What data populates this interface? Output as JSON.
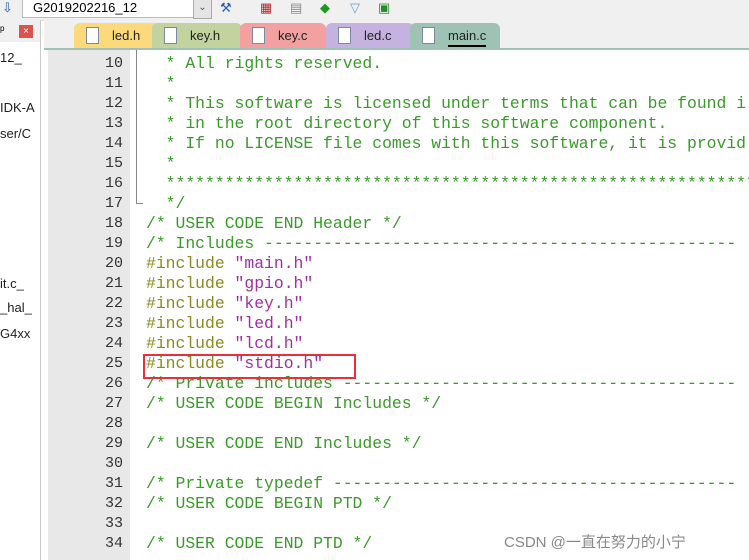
{
  "toolbar": {
    "project_combo": "G2019202216_12",
    "icons": [
      "arrow-down-icon",
      "dropdown-chevron-icon",
      "manage-components-icon",
      "options-icon",
      "layers-icon",
      "run-icon",
      "filter-icon",
      "batch-icon"
    ]
  },
  "left_panel": {
    "items": [
      "_12",
      "IDK-A",
      "ser/C",
      "_it.c",
      "_hal_",
      "G4xx"
    ],
    "close": "×"
  },
  "tabs": [
    {
      "label": "led.h",
      "color": "#fcd97a"
    },
    {
      "label": "key.h",
      "color": "#c2d3a0"
    },
    {
      "label": "key.c",
      "color": "#f2a0a0"
    },
    {
      "label": "led.c",
      "color": "#c6b2e0"
    },
    {
      "label": "main.c",
      "color": "#9ec3b5",
      "active": true
    }
  ],
  "editor": {
    "lines": [
      {
        "n": "10",
        "parts": [
          {
            "t": "  * All rights reserved.",
            "c": "cm"
          }
        ]
      },
      {
        "n": "11",
        "parts": [
          {
            "t": "  *",
            "c": "cm"
          }
        ]
      },
      {
        "n": "12",
        "parts": [
          {
            "t": "  * This software is licensed under terms that can be found i",
            "c": "cm"
          }
        ]
      },
      {
        "n": "13",
        "parts": [
          {
            "t": "  * in the root directory of this software component.",
            "c": "cm"
          }
        ]
      },
      {
        "n": "14",
        "parts": [
          {
            "t": "  * If no LICENSE file comes with this software, it is provid",
            "c": "cm"
          }
        ]
      },
      {
        "n": "15",
        "parts": [
          {
            "t": "  *",
            "c": "cm"
          }
        ]
      },
      {
        "n": "16",
        "parts": [
          {
            "t": "  *************************************************************",
            "c": "cm"
          }
        ]
      },
      {
        "n": "17",
        "parts": [
          {
            "t": "  */",
            "c": "cm"
          }
        ]
      },
      {
        "n": "18",
        "parts": [
          {
            "t": "/* USER CODE END Header */",
            "c": "cm"
          }
        ]
      },
      {
        "n": "19",
        "parts": [
          {
            "t": "/* Includes ------------------------------------------------",
            "c": "cm"
          }
        ]
      },
      {
        "n": "20",
        "parts": [
          {
            "t": "#include ",
            "c": "pp"
          },
          {
            "t": "\"main.h\"",
            "c": "st"
          }
        ]
      },
      {
        "n": "21",
        "parts": [
          {
            "t": "#include ",
            "c": "pp"
          },
          {
            "t": "\"gpio.h\"",
            "c": "st"
          }
        ]
      },
      {
        "n": "22",
        "parts": [
          {
            "t": "#include ",
            "c": "pp"
          },
          {
            "t": "\"key.h\"",
            "c": "st"
          }
        ]
      },
      {
        "n": "23",
        "parts": [
          {
            "t": "#include ",
            "c": "pp"
          },
          {
            "t": "\"led.h\"",
            "c": "st"
          }
        ]
      },
      {
        "n": "24",
        "parts": [
          {
            "t": "#include ",
            "c": "pp"
          },
          {
            "t": "\"lcd.h\"",
            "c": "st"
          }
        ]
      },
      {
        "n": "25",
        "parts": [
          {
            "t": "#include ",
            "c": "pp"
          },
          {
            "t": "\"stdio.h\"",
            "c": "st"
          }
        ]
      },
      {
        "n": "26",
        "parts": [
          {
            "t": "/* Private includes ----------------------------------------",
            "c": "cm"
          }
        ]
      },
      {
        "n": "27",
        "parts": [
          {
            "t": "/* USER CODE BEGIN Includes */",
            "c": "cm"
          }
        ]
      },
      {
        "n": "28",
        "parts": []
      },
      {
        "n": "29",
        "parts": [
          {
            "t": "/* USER CODE END Includes */",
            "c": "cm"
          }
        ]
      },
      {
        "n": "30",
        "parts": []
      },
      {
        "n": "31",
        "parts": [
          {
            "t": "/* Private typedef -----------------------------------------",
            "c": "cm"
          }
        ]
      },
      {
        "n": "32",
        "parts": [
          {
            "t": "/* USER CODE BEGIN PTD */",
            "c": "cm"
          }
        ]
      },
      {
        "n": "33",
        "parts": []
      },
      {
        "n": "34",
        "parts": [
          {
            "t": "/* USER CODE END PTD */",
            "c": "cm"
          }
        ]
      }
    ]
  },
  "highlight_color": "#e8303a",
  "watermark": "CSDN @一直在努力的小宁"
}
